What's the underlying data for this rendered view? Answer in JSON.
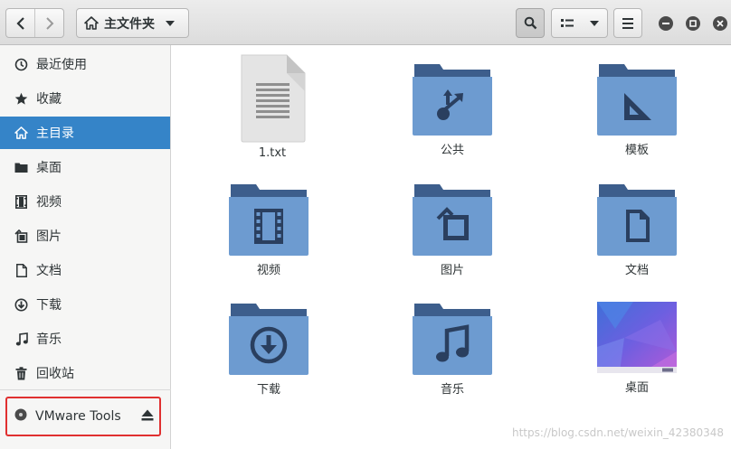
{
  "header": {
    "location": "主文件夹"
  },
  "sidebar": {
    "items": [
      {
        "label": "最近使用",
        "icon": "clock-icon"
      },
      {
        "label": "收藏",
        "icon": "star-icon"
      },
      {
        "label": "主目录",
        "icon": "home-icon",
        "active": true
      },
      {
        "label": "桌面",
        "icon": "desktop-icon"
      },
      {
        "label": "视频",
        "icon": "video-icon"
      },
      {
        "label": "图片",
        "icon": "picture-icon"
      },
      {
        "label": "文档",
        "icon": "document-icon"
      },
      {
        "label": "下载",
        "icon": "download-icon"
      },
      {
        "label": "音乐",
        "icon": "music-icon"
      },
      {
        "label": "回收站",
        "icon": "trash-icon"
      }
    ],
    "device": {
      "label": "VMware Tools",
      "icon": "disc-icon"
    }
  },
  "files": [
    {
      "name": "1.txt",
      "type": "text-file"
    },
    {
      "name": "公共",
      "type": "folder",
      "emblem": "share-icon"
    },
    {
      "name": "模板",
      "type": "folder",
      "emblem": "template-icon"
    },
    {
      "name": "视频",
      "type": "folder",
      "emblem": "video-icon"
    },
    {
      "name": "图片",
      "type": "folder",
      "emblem": "picture-icon"
    },
    {
      "name": "文档",
      "type": "folder",
      "emblem": "document-icon"
    },
    {
      "name": "下载",
      "type": "folder",
      "emblem": "download-icon"
    },
    {
      "name": "音乐",
      "type": "folder",
      "emblem": "music-icon"
    },
    {
      "name": "桌面",
      "type": "folder",
      "emblem": "desktop-preview"
    }
  ],
  "watermark": "https://blog.csdn.net/weixin_42380348",
  "colors": {
    "accent": "#3584c8",
    "folder": "#6d9bd0",
    "folder_dark": "#3d5e8c",
    "highlight_border": "#e03030"
  }
}
